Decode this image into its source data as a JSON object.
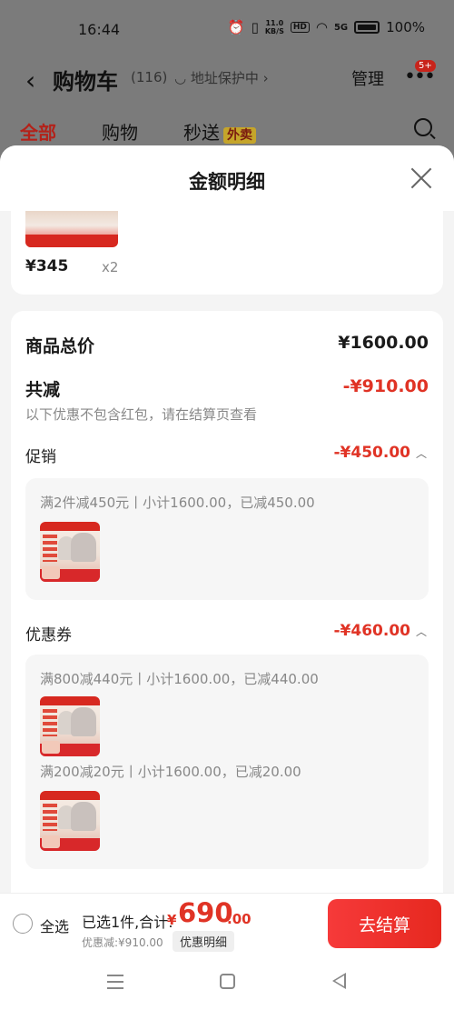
{
  "status_bar": {
    "time": "16:44",
    "net_speed_top": "11.0",
    "net_speed_unit": "KB/S",
    "hd": "HD",
    "signal": "5G",
    "battery": "100%"
  },
  "header": {
    "back_icon": "‹",
    "title": "购物车",
    "count": "(116)",
    "address_status": "地址保护中",
    "manage": "管理",
    "more_badge": "5+",
    "tabs": [
      {
        "label": "全部"
      },
      {
        "label": "购物"
      },
      {
        "label": "秒送",
        "tag": "外卖"
      }
    ]
  },
  "sheet": {
    "title": "金额明细",
    "top_item": {
      "price": "¥345",
      "quantity": "x2"
    },
    "total_label": "商品总价",
    "total_value": "¥1600.00",
    "reduce_label": "共减",
    "reduce_value": "-¥910.00",
    "reduce_note": "以下优惠不包含红包，请在结算页查看",
    "promotion": {
      "label": "促销",
      "value": "-¥450.00",
      "rules": [
        "满2件减450元丨小计1600.00，已减450.00"
      ]
    },
    "coupon": {
      "label": "优惠券",
      "value": "-¥460.00",
      "rules": [
        "满800减440元丨小计1600.00，已减440.00",
        "满200减20元丨小计1600.00，已减20.00"
      ]
    }
  },
  "bottom_bar": {
    "select_all": "全选",
    "summary": "已选1件,合计:",
    "currency": "¥",
    "total_int": "690",
    "total_dec": ".00",
    "discount": "优惠减:¥910.00",
    "detail_button": "优惠明细",
    "checkout": "去结算"
  },
  "colors": {
    "accent_red": "#e03325",
    "checkout_red": "#f2312a"
  }
}
